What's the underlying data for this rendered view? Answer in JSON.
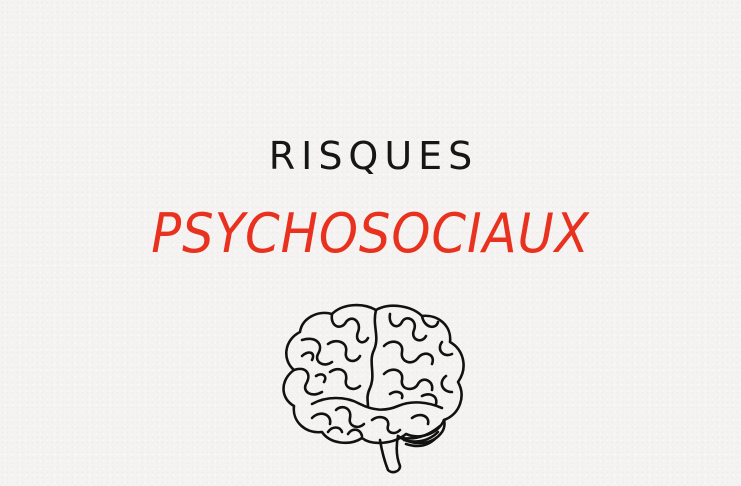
{
  "title": {
    "line1": "RISQUES",
    "line2": "PSYCHOSOCIAUX"
  },
  "illustration": {
    "icon": "brain-icon"
  },
  "colors": {
    "background": "#f4f3f1",
    "line1": "#161616",
    "accent": "#e8321f",
    "brain_stroke": "#111111"
  }
}
